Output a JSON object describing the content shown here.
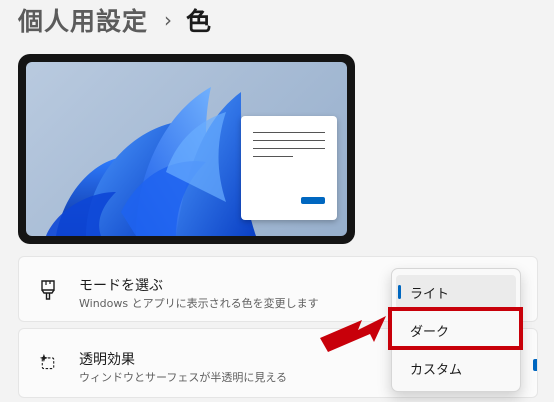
{
  "breadcrumb": {
    "parent": "個人用設定",
    "separator": "›",
    "current": "色"
  },
  "preview": {
    "window_button_color": "#0067c0",
    "wallpaper": "bloom-wallpaper"
  },
  "mode_setting": {
    "icon": "brush-icon",
    "title": "モードを選ぶ",
    "description": "Windows とアプリに表示される色を変更します"
  },
  "transparency_setting": {
    "icon": "transparency-sparkle-icon",
    "title": "透明効果",
    "description": "ウィンドウとサーフェスが半透明に見える"
  },
  "mode_dropdown": {
    "options": [
      "ライト",
      "ダーク",
      "カスタム"
    ],
    "selected": "ライト",
    "highlighted": "ダーク"
  },
  "colors": {
    "accent": "#0067c0",
    "annotation": "#c8000a"
  }
}
